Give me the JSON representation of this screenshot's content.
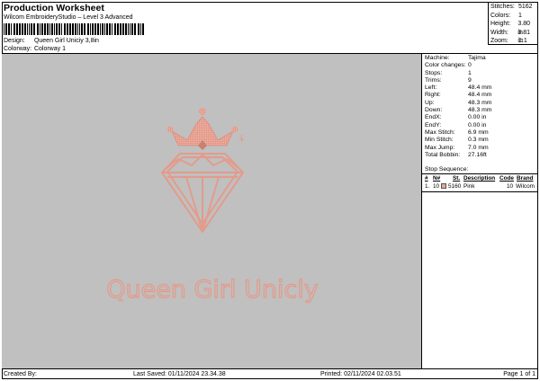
{
  "header": {
    "title": "Production Worksheet",
    "subtitle": "Wilcom EmbroideryStudio – Level 3 Advanced",
    "design_label": "Design:",
    "design_value": "Queen Girl Uniciy 3,8in",
    "colorway_label": "Colorway:",
    "colorway_value": "Colorway 1"
  },
  "stats": [
    {
      "label": "Stitches:",
      "value": "5162"
    },
    {
      "label": "Colors:",
      "value": "1"
    },
    {
      "label": "Height:",
      "value": "3.80 in"
    },
    {
      "label": "Width:",
      "value": "3.81 in"
    },
    {
      "label": "Zoom:",
      "value": "1:1"
    }
  ],
  "design_preview": {
    "text": "Queen Girl Unicly",
    "thread_color": "#e8a595",
    "background_color": "#c0c0c0"
  },
  "machine_info": [
    {
      "label": "Machine:",
      "value": "Tajima"
    },
    {
      "label": "Color changes:",
      "value": "0"
    },
    {
      "label": "Stops:",
      "value": "1"
    },
    {
      "label": "Trims:",
      "value": "9"
    },
    {
      "label": "Left:",
      "value": "48.4 mm"
    },
    {
      "label": "Right:",
      "value": "48.4 mm"
    },
    {
      "label": "Up:",
      "value": "48.3 mm"
    },
    {
      "label": "Down:",
      "value": "48.3 mm"
    },
    {
      "label": "EndX:",
      "value": "0.00 in"
    },
    {
      "label": "EndY:",
      "value": "0.00 in"
    },
    {
      "label": "Max Stitch:",
      "value": "6.9 mm"
    },
    {
      "label": "Min Stitch:",
      "value": "0.3 mm"
    },
    {
      "label": "Max Jump:",
      "value": "7.0 mm"
    },
    {
      "label": "Total Bobbin:",
      "value": "27.16ft"
    }
  ],
  "stop_sequence": {
    "title": "Stop Sequence:",
    "columns": {
      "stop": "#",
      "number": "N#",
      "st": "St.",
      "description": "Description",
      "code": "Code",
      "brand": "Brand"
    },
    "rows": [
      {
        "stop": "1.",
        "number": "10",
        "swatch_color": "#e8a595",
        "st": "5160",
        "description": "Pink",
        "code": "10",
        "brand": "Wilcom"
      }
    ]
  },
  "footer": {
    "created_by": "Created By:",
    "last_saved": "Last Saved: 01/11/2024 23.34.38",
    "printed": "Printed: 02/11/2024 02.03.51",
    "page": "Page 1 of 1"
  }
}
